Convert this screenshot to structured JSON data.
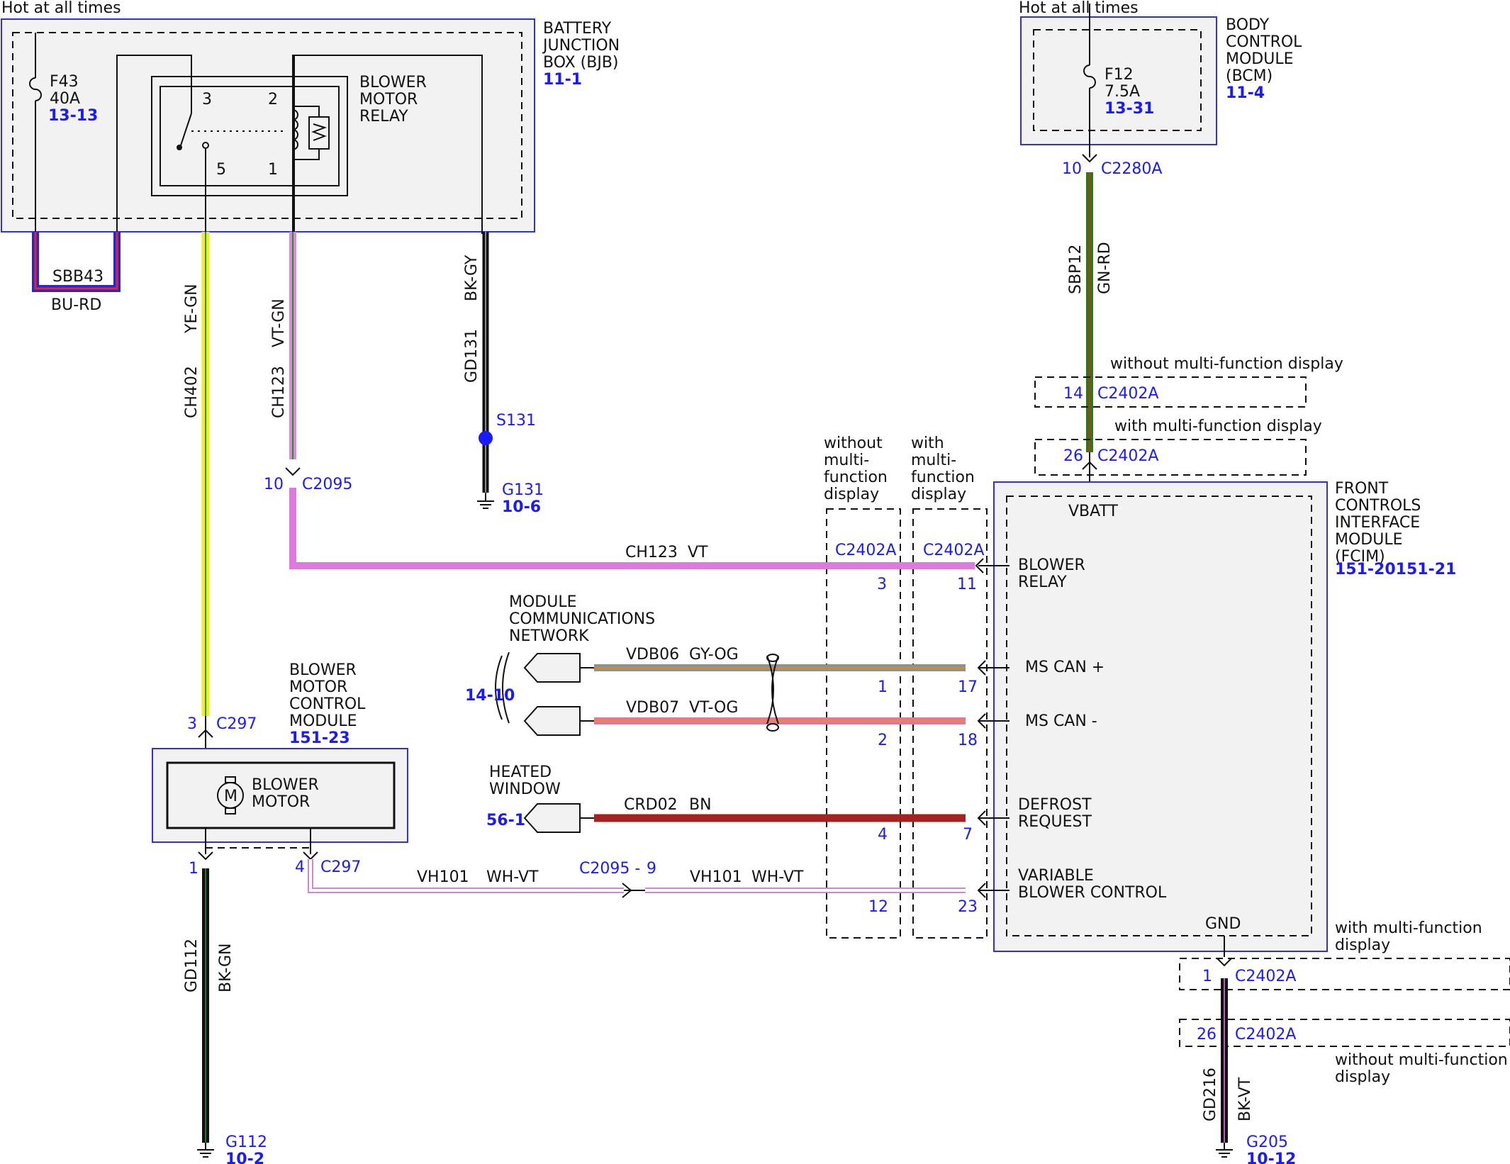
{
  "colors": {
    "module_border": "#3030e0",
    "link_blue": "#1a1aff",
    "BU-RD": [
      "#2626d9",
      "#e6242a"
    ],
    "YE-GN": [
      "#f2ee1c",
      "#2e8b2e"
    ],
    "VT-GN": [
      "#d98ad9",
      "#2e8b2e"
    ],
    "BK-GY": [
      "#111111",
      "#888888"
    ],
    "GN-RD": [
      "#2a7a1a",
      "#d42a1e"
    ],
    "VT": "#de7ade",
    "GY-OG": [
      "#909090",
      "#d98c1a"
    ],
    "VT-OG": [
      "#e0789a",
      "#e88c3a"
    ],
    "BN": "#a32222",
    "WH-VT": [
      "#ffffff",
      "#c88ac8"
    ],
    "BK-GN": [
      "#111111",
      "#2e6e2e"
    ],
    "BK-VT": [
      "#111111",
      "#b062b0"
    ]
  },
  "supply": {
    "left_hot": "Hot at all times",
    "right_hot": "Hot at all times"
  },
  "bjb": {
    "name": [
      "BATTERY",
      "JUNCTION",
      "BOX (BJB)"
    ],
    "ref": "11-1",
    "fuse_id": "F43",
    "fuse_rating": "40A",
    "fuse_ref": "13-13",
    "relay_name": [
      "BLOWER",
      "MOTOR",
      "RELAY"
    ],
    "relay_pins": [
      "3",
      "2",
      "5",
      "1"
    ]
  },
  "bcm": {
    "name": [
      "BODY",
      "CONTROL",
      "MODULE",
      "(BCM)"
    ],
    "ref": "11-4",
    "fuse_id": "F12",
    "fuse_rating": "7.5A",
    "fuse_ref": "13-31"
  },
  "fcim": {
    "name": [
      "FRONT",
      "CONTROLS",
      "INTERFACE",
      "MODULE",
      "(FCIM)"
    ],
    "ref": "151-20151-21",
    "vbatt": "VBATT",
    "gnd": "GND",
    "blower_relay": [
      "BLOWER",
      "RELAY"
    ],
    "ms_can_plus": "MS CAN +",
    "ms_can_minus": "MS CAN -",
    "defrost": [
      "DEFROST",
      "REQUEST"
    ],
    "variable_blower": [
      "VARIABLE",
      "BLOWER CONTROL"
    ]
  },
  "bmcm": {
    "name": [
      "BLOWER",
      "MOTOR",
      "CONTROL",
      "MODULE"
    ],
    "ref": "151-23",
    "motor_label": [
      "BLOWER",
      "MOTOR"
    ],
    "motor_symbol": "M"
  },
  "wires": {
    "sbb43": {
      "circuit": "SBB43",
      "color": "BU-RD"
    },
    "ch402": {
      "circuit": "CH402",
      "color": "YE-GN"
    },
    "ch123_vert": {
      "circuit": "CH123",
      "color": "VT-GN"
    },
    "gd131": {
      "circuit": "GD131",
      "color": "BK-GY"
    },
    "sbp12": {
      "circuit": "SBP12",
      "color": "GN-RD"
    },
    "ch123_horiz": {
      "circuit": "CH123",
      "color": "VT"
    },
    "vdb06": {
      "circuit": "VDB06",
      "color": "GY-OG"
    },
    "vdb07": {
      "circuit": "VDB07",
      "color": "VT-OG"
    },
    "crd02": {
      "circuit": "CRD02",
      "color": "BN"
    },
    "vh101_a": {
      "circuit": "VH101",
      "color": "WH-VT"
    },
    "vh101_b": {
      "circuit": "VH101",
      "color": "WH-VT"
    },
    "gd112": {
      "circuit": "GD112",
      "color": "BK-GN"
    },
    "gd216": {
      "circuit": "GD216",
      "color": "BK-VT"
    }
  },
  "connectors": {
    "c2095_pin": "10",
    "c2095": "C2095",
    "c2095_inline": "C2095 -",
    "c2095_inline_pin": "9",
    "c297_top_pin": "3",
    "c297_top": "C297",
    "c297_left_pin": "1",
    "c297_right_pin": "4",
    "c297_bottom": "C297",
    "c2280a_pin": "10",
    "c2280a": "C2280A",
    "c2402a": "C2402A",
    "c2402a_col1_pins": [
      "3",
      "1",
      "2",
      "4",
      "12"
    ],
    "c2402a_col2_pins": [
      "11",
      "17",
      "18",
      "7",
      "23"
    ],
    "top_without_pin": "14",
    "top_with_pin": "26",
    "bottom_with_pin": "1",
    "bottom_without_pin": "26"
  },
  "splice": {
    "id": "S131"
  },
  "grounds": {
    "g131": {
      "id": "G131",
      "ref": "10-6"
    },
    "g112": {
      "id": "G112",
      "ref": "10-2"
    },
    "g205": {
      "id": "G205",
      "ref": "10-12"
    }
  },
  "options": {
    "without_mfd": "without multi-function display",
    "with_mfd": "with multi-function display",
    "col_without": [
      "without",
      "multi-",
      "function",
      "display"
    ],
    "col_with": [
      "with",
      "multi-",
      "function",
      "display"
    ],
    "bottom_with": [
      "with multi-function",
      "display"
    ],
    "bottom_without": [
      "without multi-function",
      "display"
    ]
  },
  "network": {
    "title": [
      "MODULE",
      "COMMUNICATIONS",
      "NETWORK"
    ],
    "ref": "14-10"
  },
  "heated_window": {
    "title": [
      "HEATED",
      "WINDOW"
    ],
    "ref": "56-1"
  }
}
